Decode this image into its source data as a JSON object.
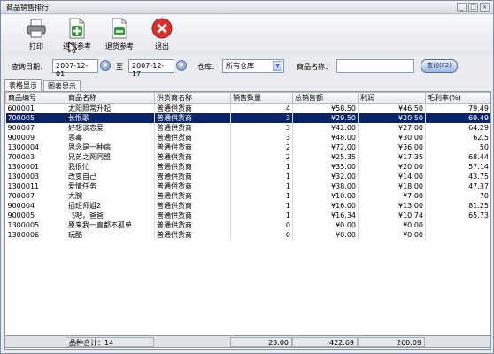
{
  "window": {
    "title": "商品销售排行"
  },
  "toolbar": {
    "print_label": "打印",
    "purchase_ref_label": "进货参考",
    "return_ref_label": "退货参考",
    "exit_label": "退出"
  },
  "filters": {
    "date_label": "查询日期：",
    "date_from": "2007-12-01",
    "to_label": "至",
    "date_to": "2007-12-17",
    "warehouse_label": "仓库：",
    "warehouse_value": "所有仓库",
    "product_label": "商品名称：",
    "product_value": "",
    "search_label": "查询(F2)"
  },
  "tabs": [
    {
      "label": "表格显示",
      "active": true
    },
    {
      "label": "图表显示",
      "active": false
    }
  ],
  "table": {
    "columns": [
      "商品编号",
      "商品名称",
      "供货商名称",
      "销售数量",
      "总销售额",
      "利润",
      "毛利率(%)"
    ],
    "rows": [
      [
        "600001",
        "太阳照常升起",
        "普通供货商",
        "4",
        "¥58.50",
        "¥46.50",
        "79.49"
      ],
      [
        "700005",
        "长恨歌",
        "普通供货商",
        "3",
        "¥29.50",
        "¥20.50",
        "69.49"
      ],
      [
        "900007",
        "好想谈恋爱",
        "普通供货商",
        "3",
        "¥42.00",
        "¥27.00",
        "64.29"
      ],
      [
        "900009",
        "恶毒",
        "普通供货商",
        "3",
        "¥48.00",
        "¥30.00",
        "62.5"
      ],
      [
        "1300004",
        "思念是一种病",
        "普通供货商",
        "2",
        "¥72.00",
        "¥36.00",
        "50"
      ],
      [
        "700003",
        "兄弟之死同盟",
        "普通供货商",
        "2",
        "¥25.35",
        "¥17.35",
        "68.44"
      ],
      [
        "1300001",
        "我很忙",
        "普通供货商",
        "1",
        "¥35.00",
        "¥20.00",
        "57.14"
      ],
      [
        "1300003",
        "改变自己",
        "普通供货商",
        "1",
        "¥32.00",
        "¥14.00",
        "43.75"
      ],
      [
        "1300011",
        "爱情任务",
        "普通供货商",
        "1",
        "¥38.00",
        "¥18.00",
        "47.37"
      ],
      [
        "700007",
        "大腕",
        "普通供货商",
        "1",
        "¥10.00",
        "¥7.00",
        "70"
      ],
      [
        "900004",
        "插班师姐2",
        "普通供货商",
        "1",
        "¥16.00",
        "¥13.00",
        "81.25"
      ],
      [
        "900005",
        "飞吧，爸爸",
        "普通供货商",
        "1",
        "¥16.34",
        "¥10.74",
        "65.73"
      ],
      [
        "1300005",
        "原来我一直都不孤单",
        "普通供货商",
        "0",
        "¥0.00",
        "¥0.00",
        ""
      ],
      [
        "1300006",
        "玩酷",
        "普通供货商",
        "0",
        "¥0.00",
        "¥0.00",
        ""
      ]
    ],
    "selected_row": 1
  },
  "footer": {
    "count_label": "品种合计：14",
    "total_qty": "23.00",
    "total_sales": "422.69",
    "total_profit": "260.09"
  },
  "icons": {
    "print": "printer-icon",
    "purchase_ref": "add-document-icon",
    "return_ref": "return-document-icon",
    "exit": "close-circle-icon"
  },
  "colors": {
    "selection": "#0a246a",
    "exit_red": "#d8322b",
    "add_green": "#2e9a3a"
  }
}
